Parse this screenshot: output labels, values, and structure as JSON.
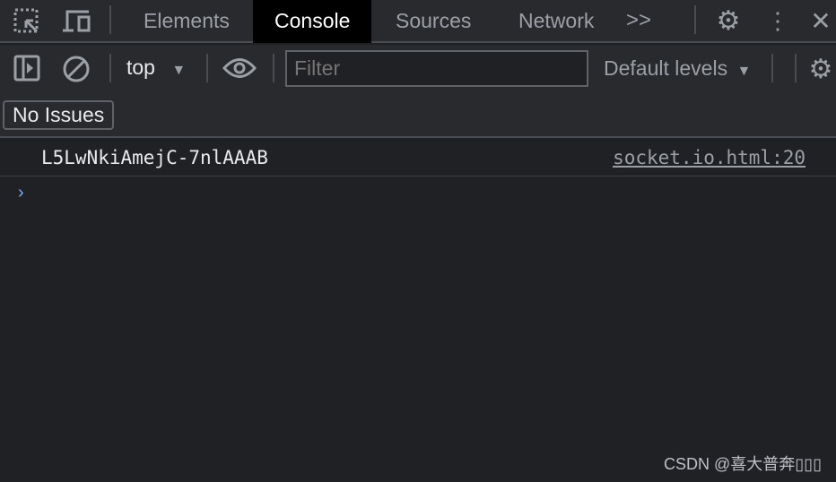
{
  "tabs": [
    {
      "label": "Elements"
    },
    {
      "label": "Console",
      "active": true
    },
    {
      "label": "Sources"
    },
    {
      "label": "Network"
    }
  ],
  "toolbar": {
    "context": "top",
    "filter_placeholder": "Filter",
    "levels": "Default levels"
  },
  "issues": {
    "label": "No Issues"
  },
  "console": {
    "messages": [
      {
        "text": "L5LwNkiAmejC-7nlAAAB",
        "source": "socket.io.html:20"
      }
    ],
    "prompt": "›"
  },
  "watermark": "CSDN @喜大普奔▯▯▯",
  "colors": {
    "background": "#202124",
    "toolbar": "#292a2d",
    "active_tab": "#000000",
    "prompt": "#7cacf8"
  }
}
